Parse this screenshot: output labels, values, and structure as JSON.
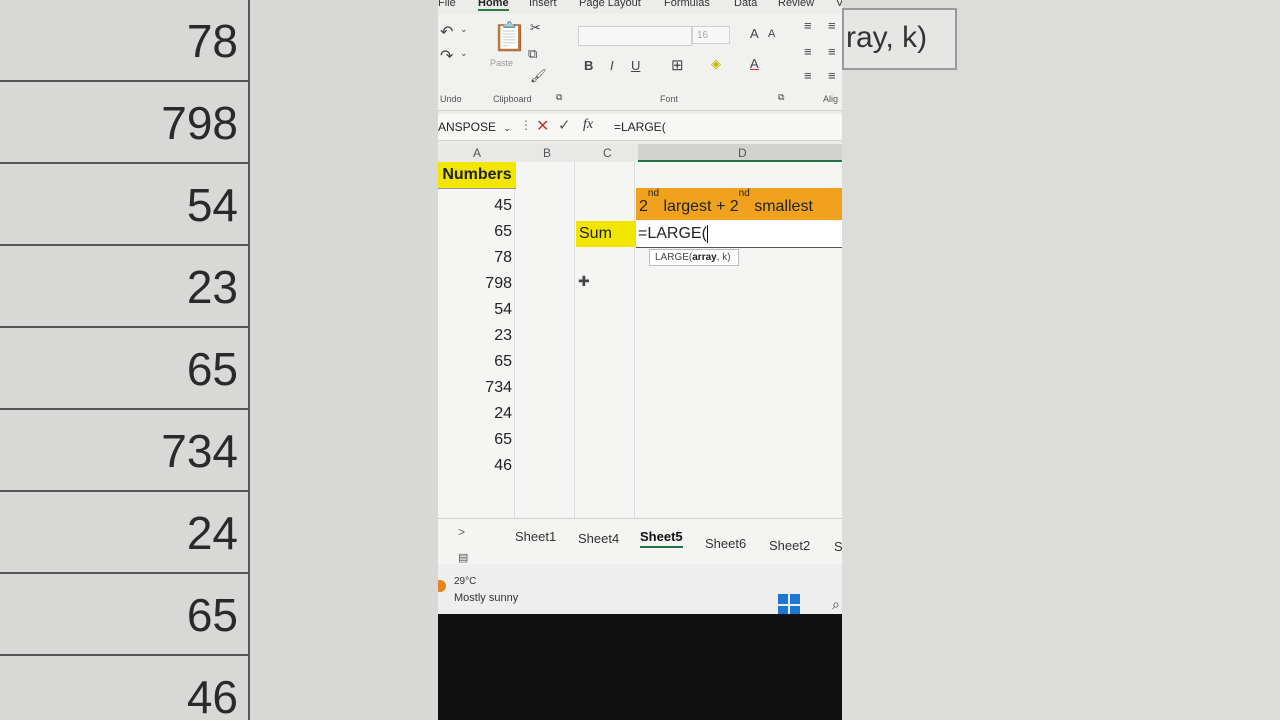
{
  "background": {
    "numbers": [
      "78",
      "798",
      "54",
      "23",
      "65",
      "734",
      "24",
      "65",
      "46"
    ],
    "tooltip_fragment": "ray, k)"
  },
  "menu": {
    "file": "File",
    "home": "Home",
    "insert": "Insert",
    "page_layout": "Page Layout",
    "formulas": "Formulas",
    "data": "Data",
    "review": "Review",
    "more": "V"
  },
  "ribbon": {
    "undo_label": "Undo",
    "paste_label": "Paste",
    "clipboard_label": "Clipboard",
    "font_label": "Font",
    "align_label": "Alig",
    "font_size": "16",
    "bold": "B",
    "italic": "I",
    "underline": "U"
  },
  "formula_bar": {
    "name_box": "ANSPOSE",
    "fx": "fx",
    "content": "=LARGE("
  },
  "columns": [
    "A",
    "B",
    "C",
    "D"
  ],
  "sheet": {
    "header_numbers": "Numbers",
    "values": [
      "45",
      "65",
      "78",
      "798",
      "54",
      "23",
      "65",
      "734",
      "24",
      "65",
      "46"
    ],
    "sum_label": "Sum",
    "title_a": "2",
    "title_a_sup": "nd",
    "title_b": " largest + 2",
    "title_b_sup": "nd",
    "title_c": " smallest",
    "edit_value": "=LARGE(",
    "tooltip_fn": "LARGE(",
    "tooltip_arg1": "array",
    "tooltip_rest": ", k)"
  },
  "tabs": {
    "arrow": ">",
    "items": [
      "Sheet1",
      "Sheet4",
      "Sheet5",
      "Sheet6",
      "Sheet2",
      "S"
    ],
    "active": "Sheet5"
  },
  "taskbar": {
    "temp": "29°C",
    "weather": "Mostly sunny"
  }
}
